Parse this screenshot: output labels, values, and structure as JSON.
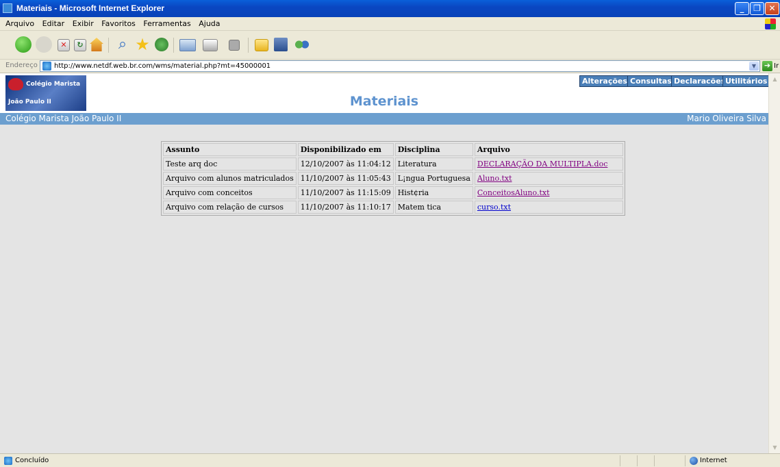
{
  "window": {
    "title": "Materiais - Microsoft Internet Explorer"
  },
  "menubar": [
    "Arquivo",
    "Editar",
    "Exibir",
    "Favoritos",
    "Ferramentas",
    "Ajuda"
  ],
  "address": {
    "label": "Endereço",
    "url": "http://www.netdf.web.br.com/wms/material.php?mt=45000001",
    "go_label": "Ir"
  },
  "site": {
    "logo_line1": "Colégio Marista",
    "logo_line2": "João Paulo II",
    "nav": [
      "Alterações",
      "Consultas",
      "Declaracões",
      "Utilitários"
    ],
    "page_title": "Materiais",
    "school_name": "Colégio Marista João Paulo II",
    "user_name": "Mario Oliveira Silva"
  },
  "table": {
    "headers": [
      "Assunto",
      "Disponibilizado em",
      "Disciplina",
      "Arquivo"
    ],
    "rows": [
      [
        "Teste arq doc",
        "12/10/2007 às 11:04:12",
        "Literatura",
        "DECLARAÇÃO DA MULTIPLA.doc"
      ],
      [
        "Arquivo com alunos matriculados",
        "11/10/2007 às 11:05:43",
        "L¡ngua Portuguesa",
        "Aluno.txt"
      ],
      [
        "Arquivo com conceitos",
        "11/10/2007 às 11:15:09",
        "Hist¢ria",
        "ConceitosAluno.txt"
      ],
      [
        "Arquivo com relação de cursos",
        "11/10/2007 às 11:10:17",
        "Matem tica",
        "curso.txt"
      ]
    ]
  },
  "status": {
    "text": "Concluído",
    "zone": "Internet"
  }
}
